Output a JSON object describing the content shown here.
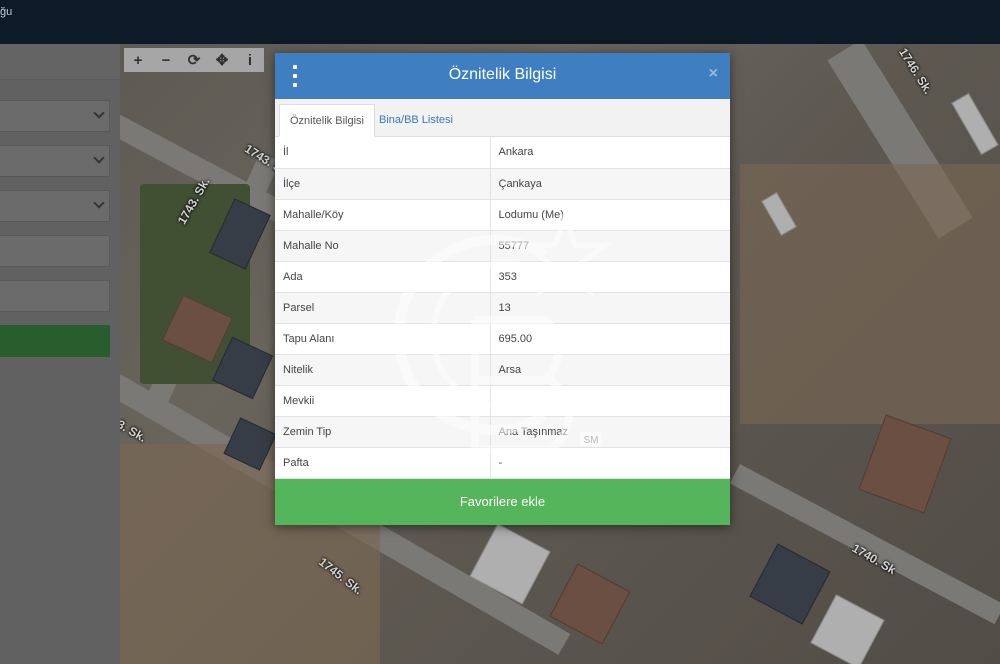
{
  "app": {
    "brand_fragment": "ğu"
  },
  "map": {
    "streets": [
      "1743. Sk.",
      "1743. Sk.",
      "1746. Sk.",
      "1740. Sk",
      "1745. Sk.",
      "3. Sk."
    ],
    "toolbar": [
      {
        "icon": "zoom-in-icon",
        "glyph": "+"
      },
      {
        "icon": "zoom-out-icon",
        "glyph": "−"
      },
      {
        "icon": "refresh-icon",
        "glyph": "⟳"
      },
      {
        "icon": "locate-icon",
        "glyph": "✥"
      },
      {
        "icon": "info-icon",
        "glyph": "i"
      }
    ]
  },
  "dialog": {
    "title": "Öznitelik Bilgisi",
    "close_glyph": "×",
    "tabs": [
      {
        "label": "Öznitelik Bilgisi",
        "active": true
      },
      {
        "label": "Bina/BB Listesi",
        "active": false
      }
    ],
    "rows": [
      {
        "key": "İl",
        "value": "Ankara"
      },
      {
        "key": "İlçe",
        "value": "Çankaya"
      },
      {
        "key": "Mahalle/Köy",
        "value": "Lodumu (Me)"
      },
      {
        "key": "Mahalle No",
        "value": "55777"
      },
      {
        "key": "Ada",
        "value": "353"
      },
      {
        "key": "Parsel",
        "value": "13"
      },
      {
        "key": "Tapu Alanı",
        "value": "695.00"
      },
      {
        "key": "Nitelik",
        "value": "Arsa"
      },
      {
        "key": "Mevkii",
        "value": ""
      },
      {
        "key": "Zemin Tip",
        "value": "Ana Taşınmaz"
      },
      {
        "key": "Pafta",
        "value": "-"
      }
    ],
    "favorite_button": "Favorilere ekle"
  },
  "watermark": {
    "text": "CB",
    "badge": "SM"
  },
  "colors": {
    "header": "#3f7fc1",
    "button": "#55b55a",
    "topbar": "#0d1a28"
  }
}
